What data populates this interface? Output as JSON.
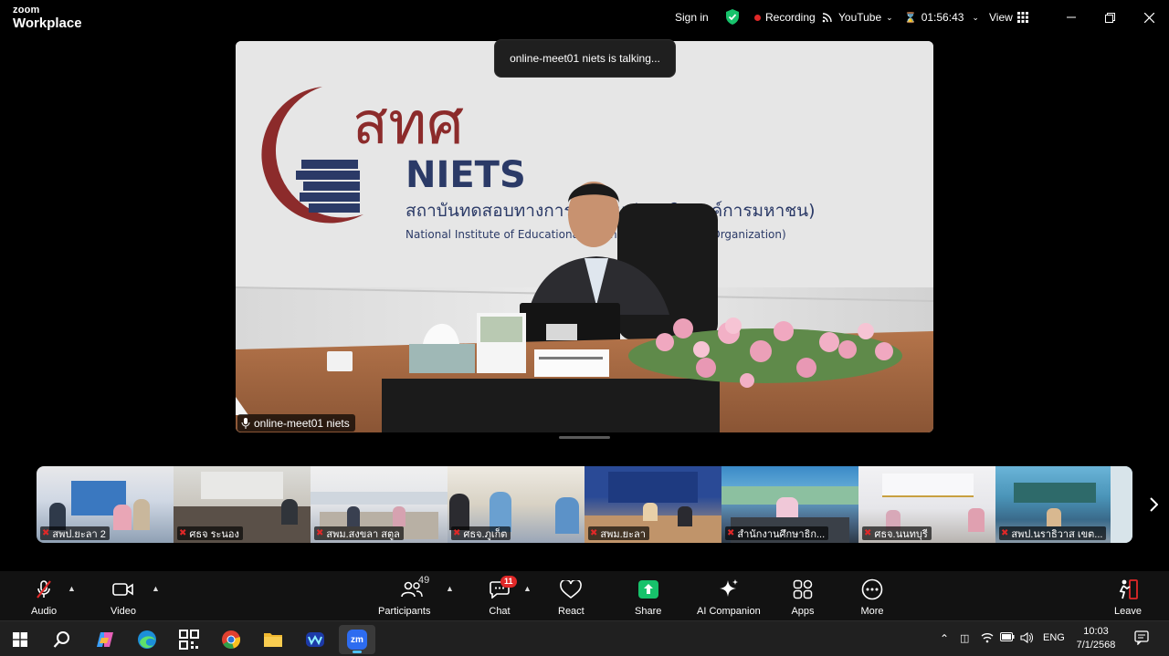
{
  "app": {
    "logo_top": "zoom",
    "logo_bottom": "Workplace"
  },
  "header": {
    "sign_in": "Sign in",
    "recording": "Recording",
    "youtube": "YouTube",
    "timer": "01:56:43",
    "view": "View"
  },
  "main_video": {
    "talking_banner": "online-meet01 niets is talking...",
    "participant_name": "online-meet01 niets",
    "backdrop": {
      "thai_logo_text": "สทศ",
      "logo_text": "NIETS",
      "thai_line": "สถาบันทดสอบทางการศึกษาแห่งชาติ (องค์การมหาชน)",
      "english_line": "National Institute of Educational Testing Service (Public Organization)"
    }
  },
  "thumbnails": [
    {
      "name": "สพป.ยะลา 2"
    },
    {
      "name": "ศธจ ระนอง"
    },
    {
      "name": "สพม.สงขลา สตูล"
    },
    {
      "name": "ศธจ.ภูเก็ต"
    },
    {
      "name": "สพม.ยะลา"
    },
    {
      "name": "สำนักงานศึกษาธิก..."
    },
    {
      "name": "ศธจ.นนทบุรี"
    },
    {
      "name": "สพป.นราธิวาส เขต..."
    }
  ],
  "toolbar": {
    "audio": "Audio",
    "video": "Video",
    "participants": "Participants",
    "participants_count": "49",
    "chat": "Chat",
    "chat_badge": "11",
    "react": "React",
    "share": "Share",
    "ai_companion": "AI Companion",
    "apps": "Apps",
    "more": "More",
    "leave": "Leave"
  },
  "taskbar": {
    "language": "ENG",
    "time": "10:03",
    "date": "7/1/2568",
    "zoom_label": "zm"
  },
  "colors": {
    "accent_green": "#17c26b",
    "recording_red": "#e02828",
    "niets_navy": "#2b3a67",
    "niets_maroon": "#8c2b2b"
  }
}
